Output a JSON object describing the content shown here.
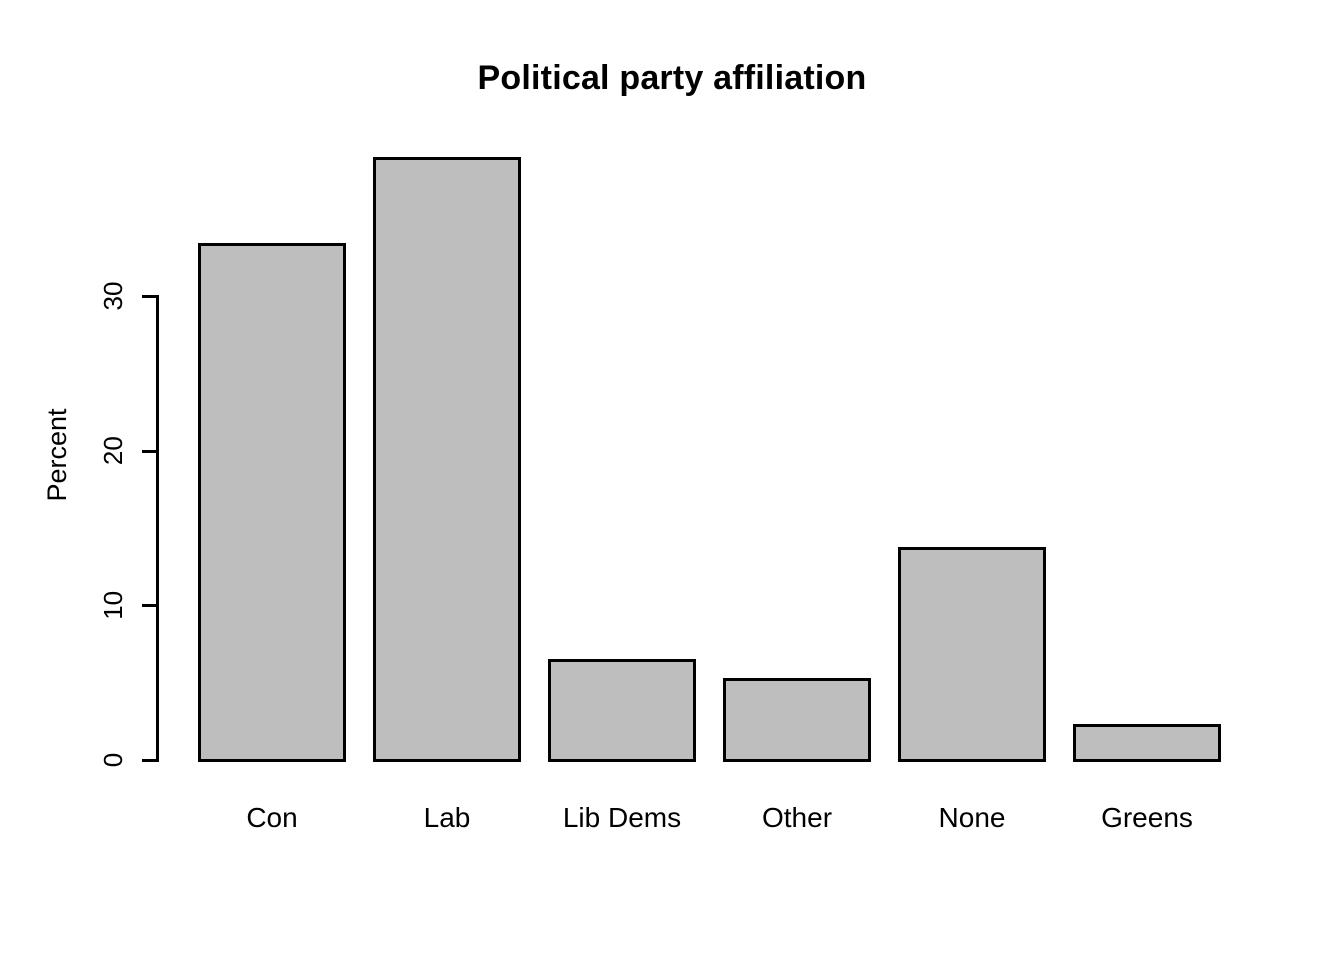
{
  "chart_data": {
    "type": "bar",
    "title": "Political party affiliation",
    "xlabel": "",
    "ylabel": "Percent",
    "categories": [
      "Con",
      "Lab",
      "Lib Dems",
      "Other",
      "None",
      "Greens"
    ],
    "values": [
      33.4,
      39.0,
      6.5,
      5.3,
      13.8,
      2.3
    ],
    "ylim": [
      0,
      39.0
    ],
    "yticks": [
      0,
      10,
      20,
      30
    ],
    "ytick_labels": [
      "0",
      "10",
      "20",
      "30"
    ],
    "grid": false,
    "legend": null,
    "bar_fill_color": "#bebebe",
    "bar_border_color": "#000000",
    "axis_color": "#000000",
    "background_color": "#ffffff"
  }
}
